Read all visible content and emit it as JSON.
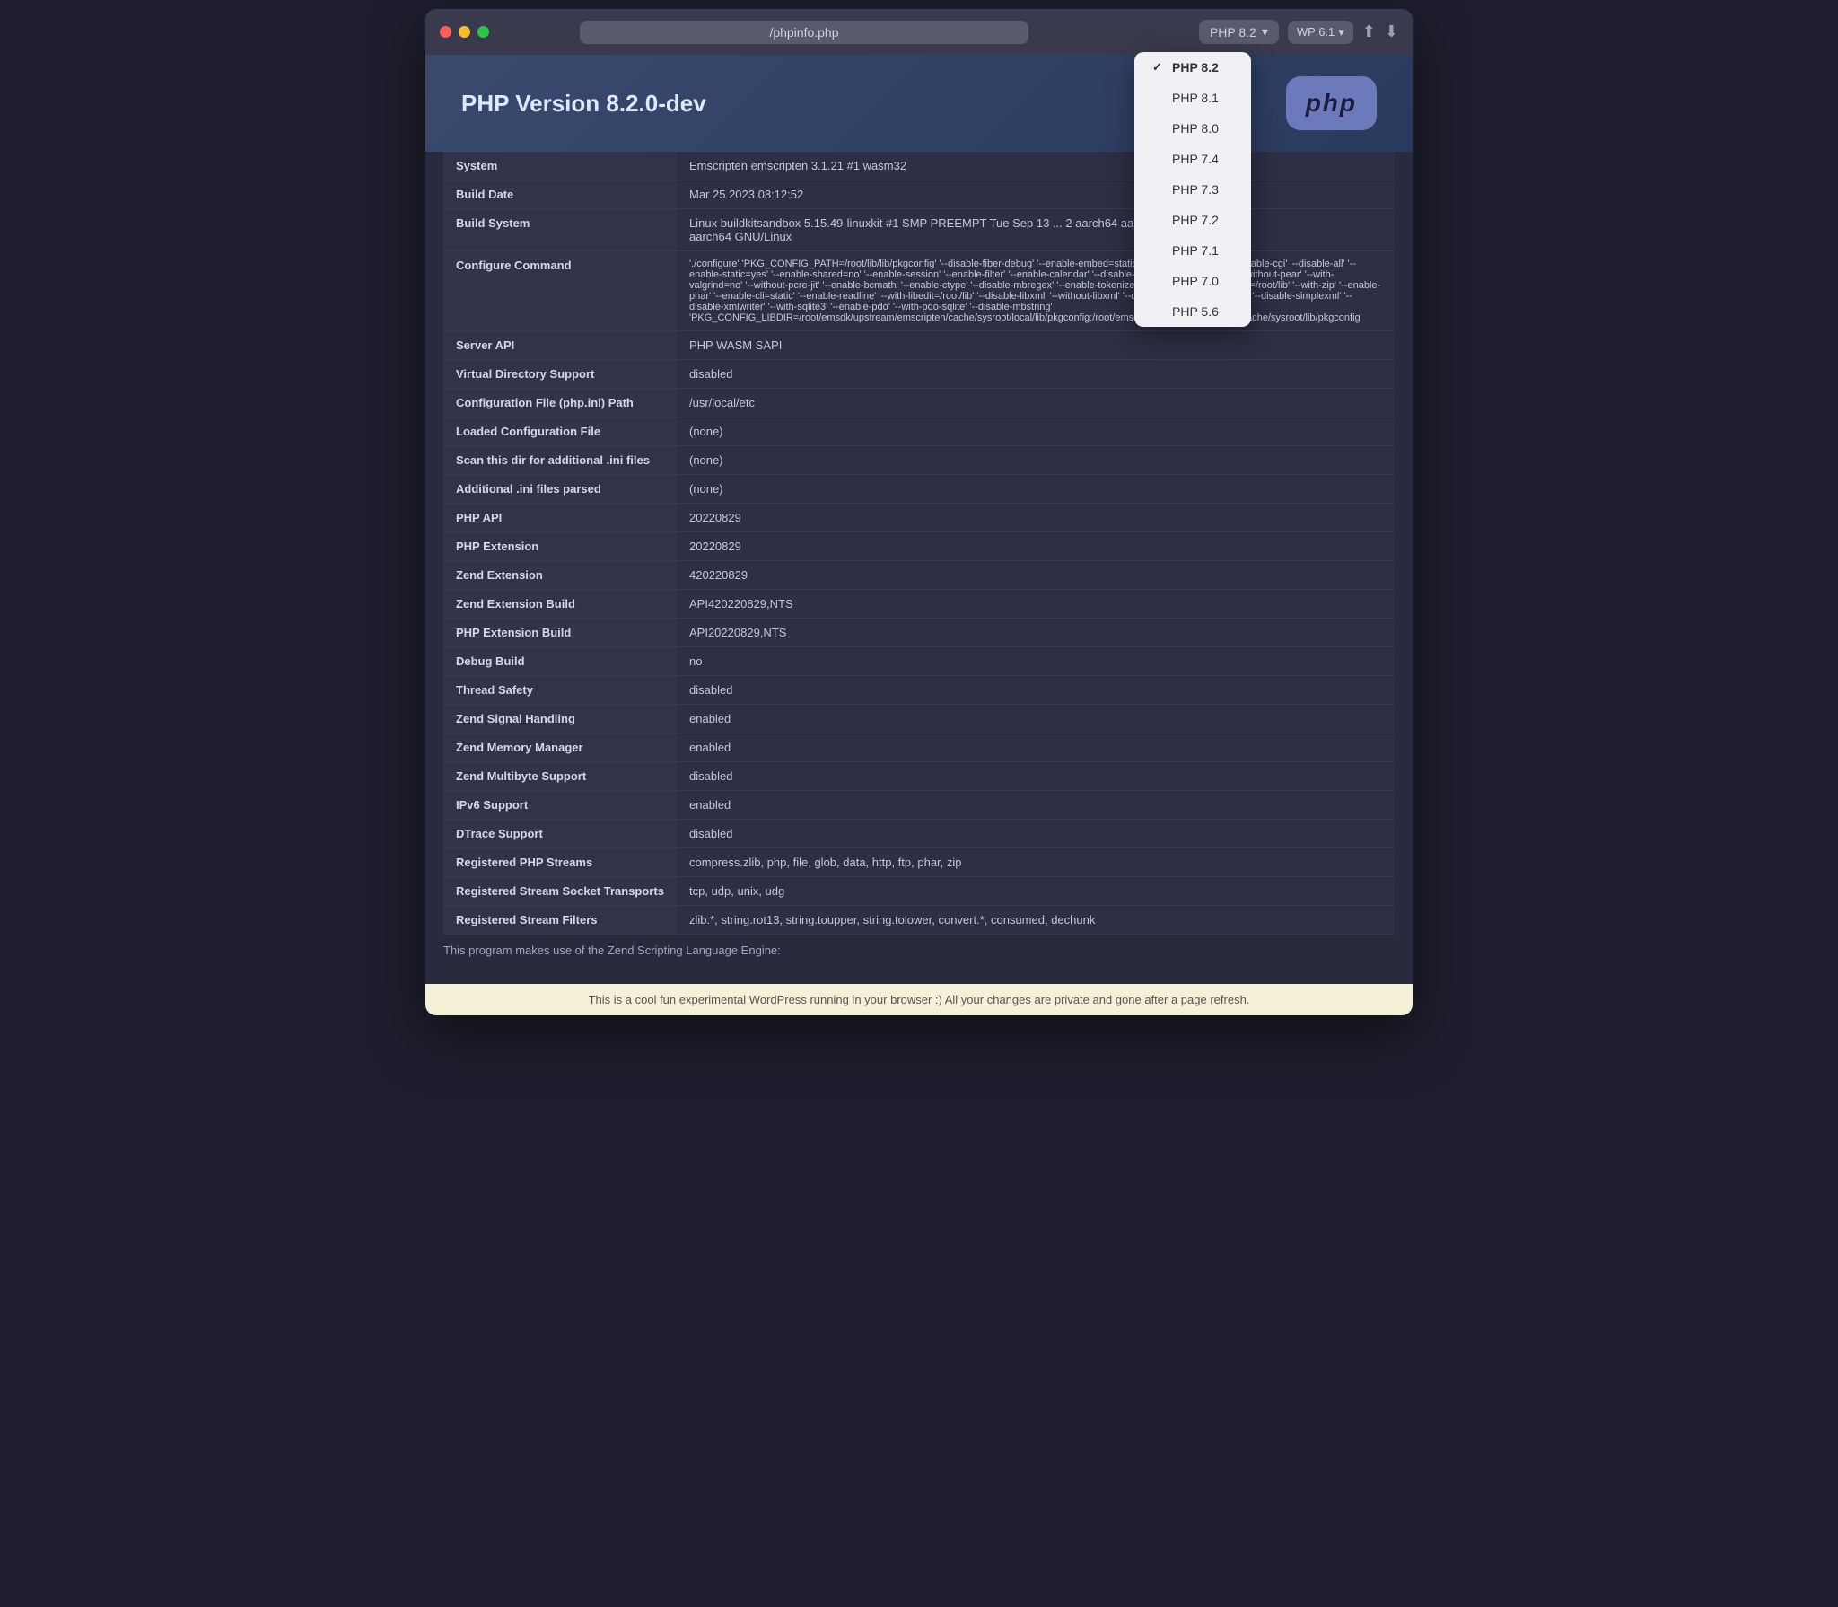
{
  "window": {
    "title": "/phpinfo.php",
    "traffic_lights": [
      "red",
      "yellow",
      "green"
    ]
  },
  "toolbar": {
    "address": "/phpinfo.php",
    "php_versions": [
      "PHP 8.2",
      "PHP 8.1",
      "PHP 8.0",
      "PHP 7.4",
      "PHP 7.3",
      "PHP 7.2",
      "PHP 7.1",
      "PHP 7.0",
      "PHP 5.6"
    ],
    "selected_php": "PHP 8.2",
    "wp_version": "WP 6.1",
    "share_icon": "⬆",
    "download_icon": "⬇"
  },
  "php_header": {
    "title": "PHP Version 8.2.0-dev",
    "logo_text": "php"
  },
  "table_rows": [
    {
      "key": "System",
      "value": "Emscripten emscripten 3.1.21 #1 wasm32"
    },
    {
      "key": "Build Date",
      "value": "Mar 25 2023 08:12:52"
    },
    {
      "key": "Build System",
      "value": "Linux buildkitsandbox 5.15.49-linuxkit #1 SMP PREEMPT Tue Sep 13 ... 2 aarch64 aarch64\naarch64 GNU/Linux"
    },
    {
      "key": "Configure Command",
      "value": "'./configure' 'PKG_CONFIG_PATH=/root/lib/lib/pkgconfig' '--disable-fiber-debug' '--enable-embed=static' '--with-layout=GNU' '--disable-cgi' '--disable-all' '--enable-static=yes' '--enable-shared=no' '--enable-session' '--enable-filter' '--enable-calendar' '--disable-rpath' '--disable-phpdg' '--without-pear' '--with-valgrind=no' '--without-pcre-jit' '--enable-bcmath' '--enable-ctype' '--disable-mbregex' '--enable-tokenizer' '--with-zlib' '--with-zlib-dir=/root/lib' '--with-zip' '--enable-phar' '--enable-cli=static' '--enable-readline' '--with-libedit=/root/lib' '--disable-libxml' '--without-libxml' '--disable-dom' '--disable-xml' '--disable-simplexml' '--disable-xmlwriter' '--with-sqlite3' '--enable-pdo' '--with-pdo-sqlite' '--disable-mbstring'\n'PKG_CONFIG_LIBDIR=/root/emsdk/upstream/emscripten/cache/sysroot/local/lib/pkgconfig:/root/emsdk/upstream/emscripten/cache/sysroot/lib/pkgconfig'"
    },
    {
      "key": "Server API",
      "value": "PHP WASM SAPI"
    },
    {
      "key": "Virtual Directory Support",
      "value": "disabled"
    },
    {
      "key": "Configuration File (php.ini) Path",
      "value": "/usr/local/etc"
    },
    {
      "key": "Loaded Configuration File",
      "value": "(none)"
    },
    {
      "key": "Scan this dir for additional .ini files",
      "value": "(none)"
    },
    {
      "key": "Additional .ini files parsed",
      "value": "(none)"
    },
    {
      "key": "PHP API",
      "value": "20220829"
    },
    {
      "key": "PHP Extension",
      "value": "20220829"
    },
    {
      "key": "Zend Extension",
      "value": "420220829"
    },
    {
      "key": "Zend Extension Build",
      "value": "API420220829,NTS"
    },
    {
      "key": "PHP Extension Build",
      "value": "API20220829,NTS"
    },
    {
      "key": "Debug Build",
      "value": "no"
    },
    {
      "key": "Thread Safety",
      "value": "disabled"
    },
    {
      "key": "Zend Signal Handling",
      "value": "enabled"
    },
    {
      "key": "Zend Memory Manager",
      "value": "enabled"
    },
    {
      "key": "Zend Multibyte Support",
      "value": "disabled"
    },
    {
      "key": "IPv6 Support",
      "value": "enabled"
    },
    {
      "key": "DTrace Support",
      "value": "disabled"
    },
    {
      "key": "Registered PHP Streams",
      "value": "compress.zlib, php, file, glob, data, http, ftp, phar, zip"
    },
    {
      "key": "Registered Stream Socket Transports",
      "value": "tcp, udp, unix, udg"
    },
    {
      "key": "Registered Stream Filters",
      "value": "zlib.*, string.rot13, string.toupper, string.tolower, convert.*, consumed, dechunk"
    }
  ],
  "footer": {
    "text": "This is a cool fun experimental WordPress running in your browser :) All your changes are private and gone after a page refresh."
  },
  "zend_footer": {
    "text": "This program makes use of the Zend Scripting Language Engine:"
  }
}
